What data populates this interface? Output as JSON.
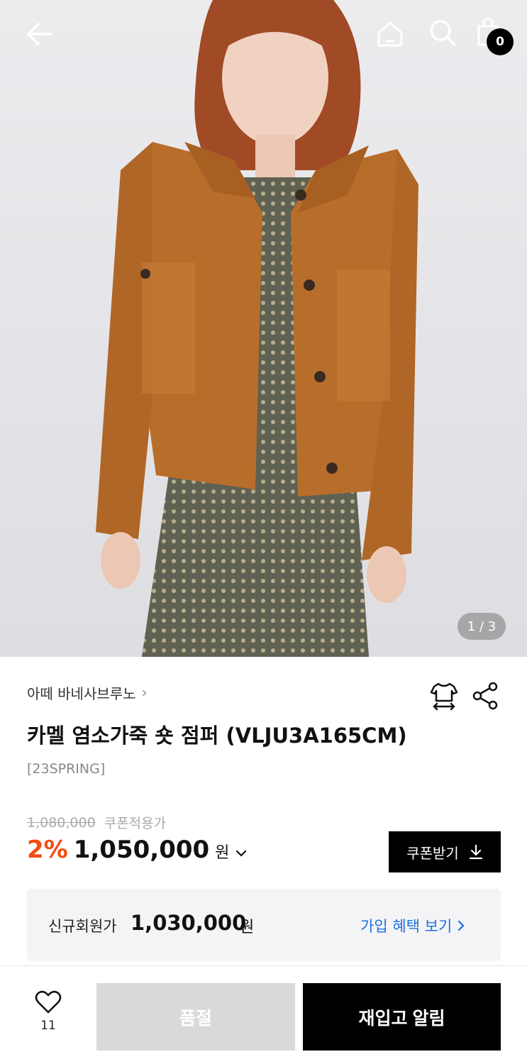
{
  "header": {
    "back_icon": "arrow-left-icon",
    "home_icon": "home-icon",
    "search_icon": "search-icon",
    "bag_icon": "shopping-bag-icon",
    "bag_count": "0"
  },
  "gallery": {
    "pager": "1 / 3",
    "image_description_icon": "product-photo"
  },
  "product": {
    "brand": "아떼 바네사브루노",
    "title": "카멜 염소가죽 숏 점퍼 (VLJU3A165CM)",
    "season": "[23SPRING]",
    "original_price": "1,080,000",
    "coupon_note": "쿠폰적용가",
    "discount": "2%",
    "price": "1,050,000",
    "currency": "원",
    "size_icon": "size-guide-icon",
    "share_icon": "share-icon"
  },
  "coupon_button": {
    "label": "쿠폰받기",
    "icon": "download-icon"
  },
  "member": {
    "label": "신규회원가",
    "price": "1,030,000",
    "currency": "원",
    "link": "가입 혜택 보기"
  },
  "bottom_bar": {
    "like_icon": "heart-icon",
    "like_count": "11",
    "soldout_label": "품절",
    "restock_label": "재입고 알림"
  },
  "colors": {
    "discount": "#f24b0f",
    "link": "#1f6fe0",
    "primary_button": "#000000",
    "disabled_button": "#d9d9d9",
    "member_box": "#f4f4f6"
  }
}
